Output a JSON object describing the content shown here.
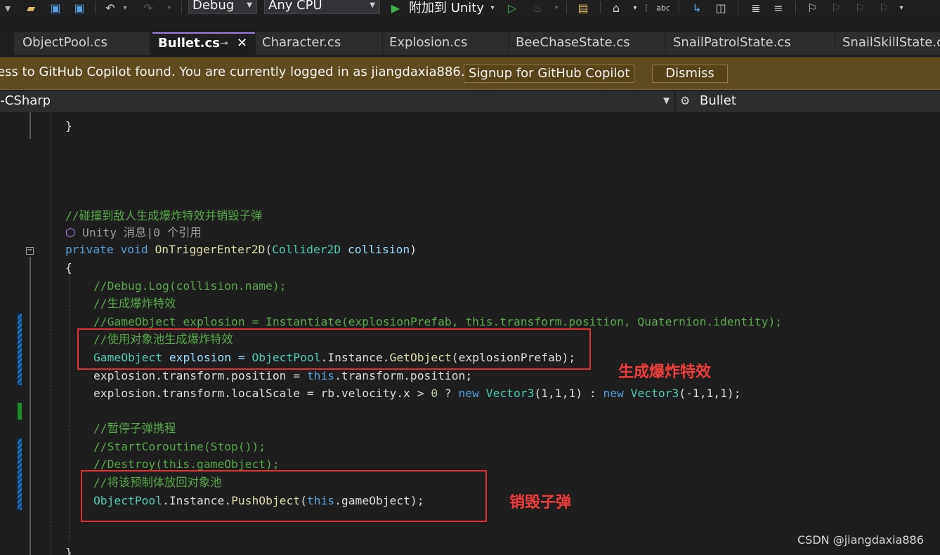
{
  "toolbar": {
    "config_combo": "Debug",
    "platform_combo": "Any CPU",
    "attach_label": "附加到 Unity"
  },
  "tabs": [
    {
      "label": "ObjectPool.cs"
    },
    {
      "label": "Bullet.cs"
    },
    {
      "label": "Character.cs"
    },
    {
      "label": "Explosion.cs"
    },
    {
      "label": "BeeChaseState.cs"
    },
    {
      "label": "SnailPatrolState.cs"
    },
    {
      "label": "SnailSkillState.cs"
    }
  ],
  "infobar": {
    "message": "ess to GitHub Copilot found. You are currently logged in as jiangdaxia886.",
    "signup_label": "Signup for GitHub Copilot",
    "dismiss_label": "Dismiss"
  },
  "navbar": {
    "project": "y-CSharp",
    "member": "Bullet"
  },
  "code": {
    "close_brace": "}",
    "comment_header": "//碰撞到敌人生成爆炸特效并销毁子弹",
    "codelens": "Unity 消息|0 个引用",
    "kw_private": "private",
    "kw_void": "void",
    "method_name": "OnTriggerEnter2D",
    "paren_open": "(",
    "param_type": "Collider2D",
    "param_name": " collision",
    "paren_close": ")",
    "open_brace": "{",
    "comment_debug": "//Debug.Log(collision.name);",
    "comment_gen": "//生成爆炸特效",
    "comment_old": "//GameObject explosion = Instantiate(explosionPrefab, this.transform.position, Quaternion.identity);",
    "comment_pool": "//使用对象池生成爆炸特效",
    "line_get_type": "GameObject",
    "line_get_var": " explosion = ",
    "line_get_pool": "ObjectPool",
    "line_get_inst": ".Instance.",
    "line_get_method": "GetObject",
    "line_get_args": "(explosionPrefab);",
    "line_pos_a": "explosion.transform.position = ",
    "line_pos_this": "this",
    "line_pos_b": ".transform.position;",
    "line_scale_a": "explosion.transform.localScale = rb.velocity.x > ",
    "line_scale_zero": "0",
    "line_scale_q": " ? ",
    "line_scale_new1": "new",
    "line_scale_v1": " Vector3",
    "line_scale_args1": "(1,1,1)",
    "line_scale_colon": " : ",
    "line_scale_new2": "new",
    "line_scale_v2": " Vector3",
    "line_scale_args2": "(-1,1,1);",
    "comment_pause": "//暂停子弹携程",
    "comment_coroutine": "//StartCoroutine(Stop());",
    "comment_destroy": "//Destroy(this.gameObject);",
    "comment_push": "//将该预制体放回对象池",
    "line_push_pool": "ObjectPool",
    "line_push_a": ".Instance.",
    "line_push_method": "PushObject",
    "line_push_paren": "(",
    "line_push_this": "this",
    "line_push_b": ".gameObject);"
  },
  "annotations": {
    "generate": "生成爆炸特效",
    "destroy": "销毁子弹"
  },
  "watermark": "CSDN @jiangdaxia886",
  "colors": {
    "infobar_bg": "#5e4b1f",
    "annotation_red": "#e03131",
    "keyword": "#569cd6",
    "type": "#4ec9b0",
    "method": "#dcdcaa",
    "comment": "#57a64a"
  },
  "icons": [
    "undo-icon",
    "redo-icon",
    "save-icon",
    "save-all-icon",
    "open-folder-icon",
    "play-icon",
    "start-without-debug-icon",
    "hot-reload-icon",
    "bookmark-icon",
    "fold-collapse-icon",
    "class-icon",
    "unity-icon"
  ]
}
